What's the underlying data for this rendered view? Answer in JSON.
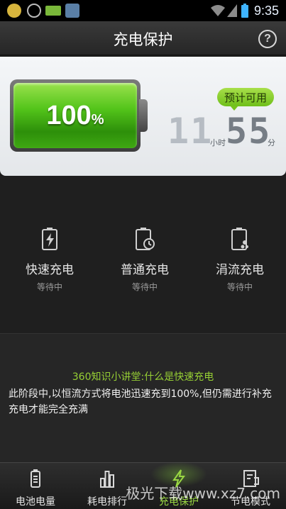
{
  "status_bar": {
    "time": "9:35"
  },
  "header": {
    "title": "充电保护",
    "help": "?"
  },
  "battery": {
    "percent": "100",
    "percent_sign": "%"
  },
  "estimate": {
    "badge": "预计可用",
    "hours": "11",
    "hours_unit": "小时",
    "minutes": "55",
    "minutes_unit": "分"
  },
  "modes": [
    {
      "label": "快速充电",
      "status": "等待中",
      "icon": "fast-charge-icon"
    },
    {
      "label": "普通充电",
      "status": "等待中",
      "icon": "normal-charge-icon"
    },
    {
      "label": "涓流充电",
      "status": "等待中",
      "icon": "trickle-charge-icon"
    }
  ],
  "info": {
    "title": "360知识小讲堂:什么是快速充电",
    "body": "此阶段中,以恒流方式将电池迅速充到100%,但仍需进行补充充电才能完全充满"
  },
  "nav": [
    {
      "label": "电池电量",
      "icon": "battery-icon"
    },
    {
      "label": "耗电排行",
      "icon": "bar-chart-icon"
    },
    {
      "label": "充电保护",
      "icon": "lightning-icon",
      "active": true
    },
    {
      "label": "节电模式",
      "icon": "power-save-icon"
    }
  ],
  "watermark": "极光下载www.xz7.com",
  "colors": {
    "accent_green": "#9ad843",
    "battery_green": "#53c41a"
  }
}
